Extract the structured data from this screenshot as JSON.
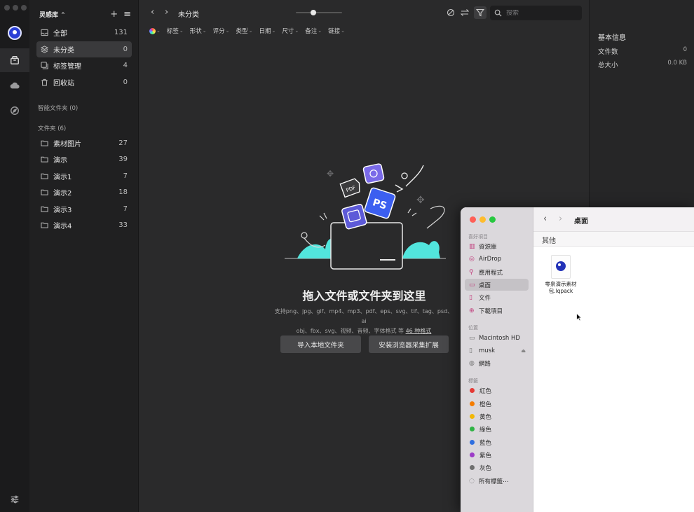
{
  "app": {
    "library_title": "灵感库",
    "breadcrumb": "未分类"
  },
  "library_items": [
    {
      "label": "全部",
      "count": "131",
      "icon": "inbox-icon"
    },
    {
      "label": "未分类",
      "count": "0",
      "icon": "layers-icon"
    },
    {
      "label": "标签管理",
      "count": "4",
      "icon": "tag-manage-icon"
    },
    {
      "label": "回收站",
      "count": "0",
      "icon": "trash-icon"
    }
  ],
  "sections": {
    "smart_folders": "智能文件夹 (0)",
    "folders": "文件夹 (6)"
  },
  "folders": [
    {
      "label": "素材图片",
      "count": "27"
    },
    {
      "label": "演示",
      "count": "39"
    },
    {
      "label": "演示1",
      "count": "7"
    },
    {
      "label": "演示2",
      "count": "18"
    },
    {
      "label": "演示3",
      "count": "7"
    },
    {
      "label": "演示4",
      "count": "33"
    }
  ],
  "search": {
    "placeholder": "搜索"
  },
  "filters": [
    "标签",
    "形状",
    "评分",
    "类型",
    "日期",
    "尺寸",
    "备注",
    "链接"
  ],
  "empty_state": {
    "title": "拖入文件或文件夹到这里",
    "desc_line1": "支持png、jpg、gif、mp4、mp3、pdf、eps、svg、tif、tag、psd、ai",
    "desc_line2": "obj、fbx、svg、视频、音频、字体格式 等",
    "desc_link": "46 种格式",
    "button_import": "导入本地文件夹",
    "button_extension": "安装浏览器采集扩展"
  },
  "info_panel": {
    "title": "基本信息",
    "file_count_label": "文件数",
    "file_count_value": "0",
    "total_size_label": "总大小",
    "total_size_value": "0.0 KB"
  },
  "finder": {
    "title": "桌面",
    "group_header": "其他",
    "favorites_label": "喜好項目",
    "favorites": [
      "資源庫",
      "AirDrop",
      "應用程式",
      "桌面",
      "文件",
      "下載項目"
    ],
    "locations_label": "位置",
    "locations": [
      "Macintosh HD",
      "musk",
      "網路"
    ],
    "tags_label": "標籤",
    "tags": [
      {
        "label": "紅色",
        "color": "#e53935"
      },
      {
        "label": "橙色",
        "color": "#f57c00"
      },
      {
        "label": "黃色",
        "color": "#f2b705"
      },
      {
        "label": "綠色",
        "color": "#2fb344"
      },
      {
        "label": "藍色",
        "color": "#2f6fe0"
      },
      {
        "label": "紫色",
        "color": "#9c3bc7"
      },
      {
        "label": "灰色",
        "color": "#6e6e6e"
      }
    ],
    "all_tags": "所有標籤⋯",
    "file_name": "零泉演示素材包.lqpack"
  }
}
